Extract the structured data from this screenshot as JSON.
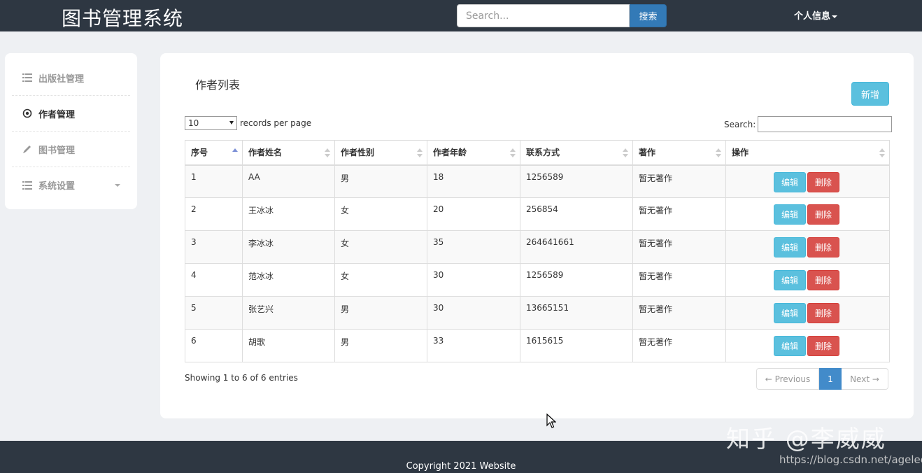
{
  "header": {
    "brand": "图书管理系统",
    "search_placeholder": "Search...",
    "search_button": "搜索",
    "user_menu": "个人信息"
  },
  "sidebar": {
    "items": [
      {
        "label": "出版社管理",
        "icon": "list-icon"
      },
      {
        "label": "作者管理",
        "icon": "target-icon",
        "active": true
      },
      {
        "label": "图书管理",
        "icon": "pencil-icon"
      },
      {
        "label": "系统设置",
        "icon": "list-icon",
        "has_dropdown": true
      }
    ]
  },
  "main": {
    "title": "作者列表",
    "add_button": "新增",
    "length_value": "10",
    "length_suffix": "records per page",
    "filter_label": "Search:",
    "columns": [
      "序号",
      "作者姓名",
      "作者性别",
      "作者年龄",
      "联系方式",
      "著作",
      "操作"
    ],
    "rows": [
      {
        "id": "1",
        "name": "AA",
        "gender": "男",
        "age": "18",
        "contact": "1256589",
        "works": "暂无著作"
      },
      {
        "id": "2",
        "name": "王冰冰",
        "gender": "女",
        "age": "20",
        "contact": "256854",
        "works": "暂无著作"
      },
      {
        "id": "3",
        "name": "李冰冰",
        "gender": "女",
        "age": "35",
        "contact": "264641661",
        "works": "暂无著作"
      },
      {
        "id": "4",
        "name": "范冰冰",
        "gender": "女",
        "age": "30",
        "contact": "1256589",
        "works": "暂无著作"
      },
      {
        "id": "5",
        "name": "张艺兴",
        "gender": "男",
        "age": "30",
        "contact": "13665151",
        "works": "暂无著作"
      },
      {
        "id": "6",
        "name": "胡歌",
        "gender": "男",
        "age": "33",
        "contact": "1615615",
        "works": "暂无著作"
      }
    ],
    "edit_label": "编辑",
    "delete_label": "删除",
    "info": "Showing 1 to 6 of 6 entries",
    "pager": {
      "prev": "← Previous",
      "current": "1",
      "next": "Next →"
    }
  },
  "footer": {
    "copyright": "Copyright 2021 Website"
  },
  "watermark": {
    "main": "知乎 @李威威",
    "url": "https://blog.csdn.net/agelee"
  },
  "colors": {
    "navbar": "#2e3742",
    "primary": "#337ab7",
    "info": "#5bc0de",
    "danger": "#d9534f"
  }
}
